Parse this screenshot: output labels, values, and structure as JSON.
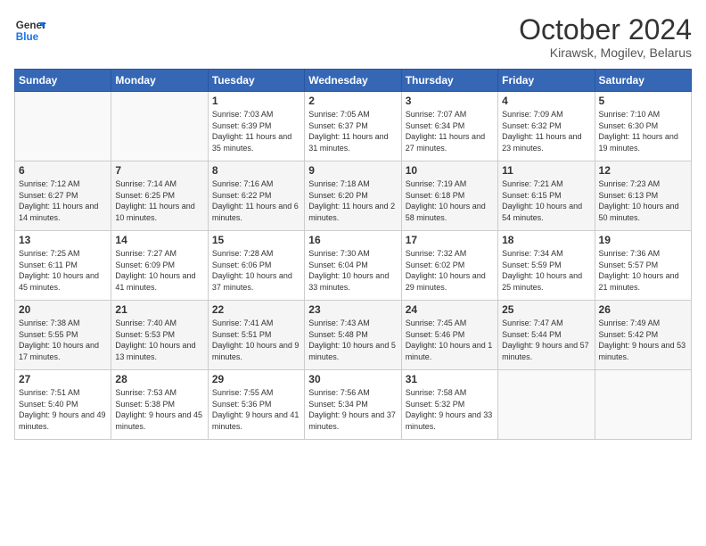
{
  "header": {
    "logo_line1": "General",
    "logo_line2": "Blue",
    "month": "October 2024",
    "location": "Kirawsk, Mogilev, Belarus"
  },
  "weekdays": [
    "Sunday",
    "Monday",
    "Tuesday",
    "Wednesday",
    "Thursday",
    "Friday",
    "Saturday"
  ],
  "weeks": [
    [
      {
        "day": "",
        "text": ""
      },
      {
        "day": "",
        "text": ""
      },
      {
        "day": "1",
        "text": "Sunrise: 7:03 AM\nSunset: 6:39 PM\nDaylight: 11 hours and 35 minutes."
      },
      {
        "day": "2",
        "text": "Sunrise: 7:05 AM\nSunset: 6:37 PM\nDaylight: 11 hours and 31 minutes."
      },
      {
        "day": "3",
        "text": "Sunrise: 7:07 AM\nSunset: 6:34 PM\nDaylight: 11 hours and 27 minutes."
      },
      {
        "day": "4",
        "text": "Sunrise: 7:09 AM\nSunset: 6:32 PM\nDaylight: 11 hours and 23 minutes."
      },
      {
        "day": "5",
        "text": "Sunrise: 7:10 AM\nSunset: 6:30 PM\nDaylight: 11 hours and 19 minutes."
      }
    ],
    [
      {
        "day": "6",
        "text": "Sunrise: 7:12 AM\nSunset: 6:27 PM\nDaylight: 11 hours and 14 minutes."
      },
      {
        "day": "7",
        "text": "Sunrise: 7:14 AM\nSunset: 6:25 PM\nDaylight: 11 hours and 10 minutes."
      },
      {
        "day": "8",
        "text": "Sunrise: 7:16 AM\nSunset: 6:22 PM\nDaylight: 11 hours and 6 minutes."
      },
      {
        "day": "9",
        "text": "Sunrise: 7:18 AM\nSunset: 6:20 PM\nDaylight: 11 hours and 2 minutes."
      },
      {
        "day": "10",
        "text": "Sunrise: 7:19 AM\nSunset: 6:18 PM\nDaylight: 10 hours and 58 minutes."
      },
      {
        "day": "11",
        "text": "Sunrise: 7:21 AM\nSunset: 6:15 PM\nDaylight: 10 hours and 54 minutes."
      },
      {
        "day": "12",
        "text": "Sunrise: 7:23 AM\nSunset: 6:13 PM\nDaylight: 10 hours and 50 minutes."
      }
    ],
    [
      {
        "day": "13",
        "text": "Sunrise: 7:25 AM\nSunset: 6:11 PM\nDaylight: 10 hours and 45 minutes."
      },
      {
        "day": "14",
        "text": "Sunrise: 7:27 AM\nSunset: 6:09 PM\nDaylight: 10 hours and 41 minutes."
      },
      {
        "day": "15",
        "text": "Sunrise: 7:28 AM\nSunset: 6:06 PM\nDaylight: 10 hours and 37 minutes."
      },
      {
        "day": "16",
        "text": "Sunrise: 7:30 AM\nSunset: 6:04 PM\nDaylight: 10 hours and 33 minutes."
      },
      {
        "day": "17",
        "text": "Sunrise: 7:32 AM\nSunset: 6:02 PM\nDaylight: 10 hours and 29 minutes."
      },
      {
        "day": "18",
        "text": "Sunrise: 7:34 AM\nSunset: 5:59 PM\nDaylight: 10 hours and 25 minutes."
      },
      {
        "day": "19",
        "text": "Sunrise: 7:36 AM\nSunset: 5:57 PM\nDaylight: 10 hours and 21 minutes."
      }
    ],
    [
      {
        "day": "20",
        "text": "Sunrise: 7:38 AM\nSunset: 5:55 PM\nDaylight: 10 hours and 17 minutes."
      },
      {
        "day": "21",
        "text": "Sunrise: 7:40 AM\nSunset: 5:53 PM\nDaylight: 10 hours and 13 minutes."
      },
      {
        "day": "22",
        "text": "Sunrise: 7:41 AM\nSunset: 5:51 PM\nDaylight: 10 hours and 9 minutes."
      },
      {
        "day": "23",
        "text": "Sunrise: 7:43 AM\nSunset: 5:48 PM\nDaylight: 10 hours and 5 minutes."
      },
      {
        "day": "24",
        "text": "Sunrise: 7:45 AM\nSunset: 5:46 PM\nDaylight: 10 hours and 1 minute."
      },
      {
        "day": "25",
        "text": "Sunrise: 7:47 AM\nSunset: 5:44 PM\nDaylight: 9 hours and 57 minutes."
      },
      {
        "day": "26",
        "text": "Sunrise: 7:49 AM\nSunset: 5:42 PM\nDaylight: 9 hours and 53 minutes."
      }
    ],
    [
      {
        "day": "27",
        "text": "Sunrise: 7:51 AM\nSunset: 5:40 PM\nDaylight: 9 hours and 49 minutes."
      },
      {
        "day": "28",
        "text": "Sunrise: 7:53 AM\nSunset: 5:38 PM\nDaylight: 9 hours and 45 minutes."
      },
      {
        "day": "29",
        "text": "Sunrise: 7:55 AM\nSunset: 5:36 PM\nDaylight: 9 hours and 41 minutes."
      },
      {
        "day": "30",
        "text": "Sunrise: 7:56 AM\nSunset: 5:34 PM\nDaylight: 9 hours and 37 minutes."
      },
      {
        "day": "31",
        "text": "Sunrise: 7:58 AM\nSunset: 5:32 PM\nDaylight: 9 hours and 33 minutes."
      },
      {
        "day": "",
        "text": ""
      },
      {
        "day": "",
        "text": ""
      }
    ]
  ]
}
